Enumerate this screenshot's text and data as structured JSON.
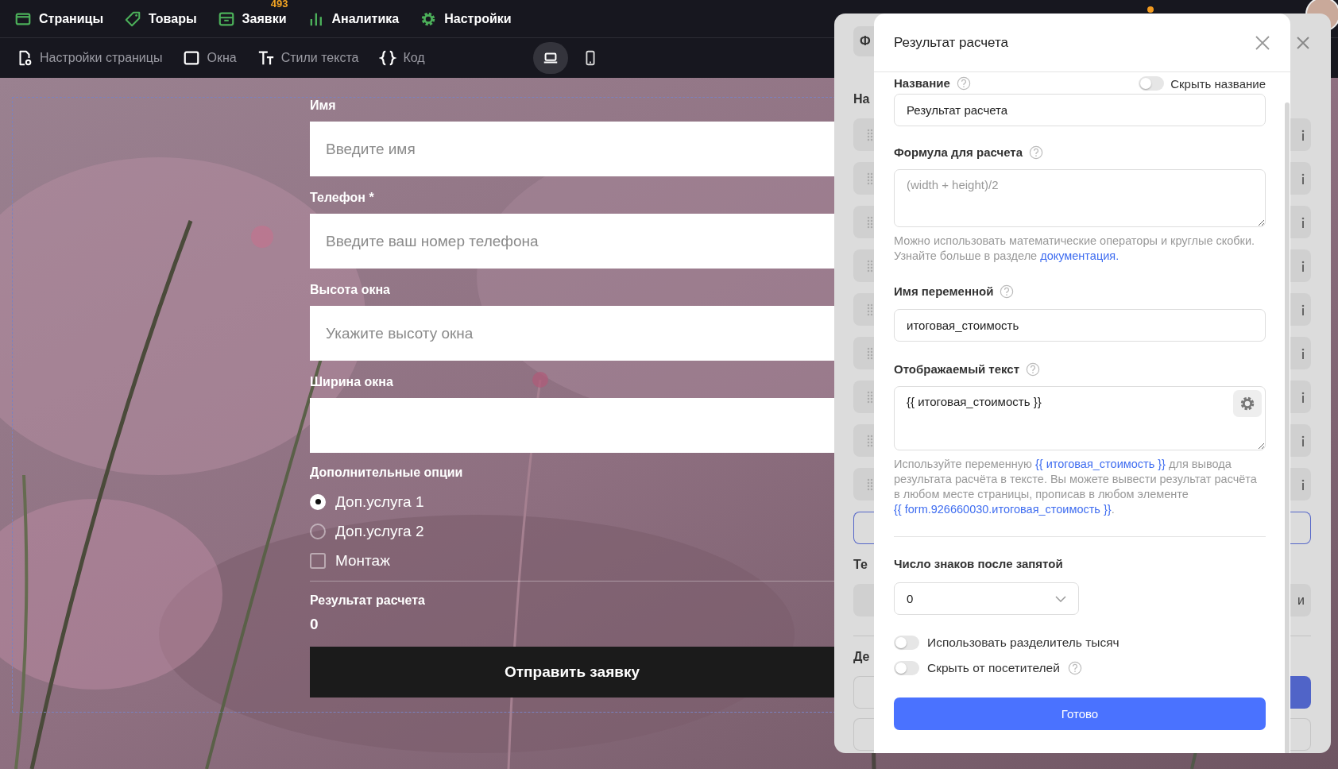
{
  "nav": {
    "items": [
      {
        "kind": "pages",
        "label": "Страницы"
      },
      {
        "kind": "products",
        "label": "Товары"
      },
      {
        "kind": "orders",
        "label": "Заявки",
        "badge": "493"
      },
      {
        "kind": "analytics",
        "label": "Аналитика"
      },
      {
        "kind": "settings",
        "label": "Настройки"
      }
    ]
  },
  "toolbar": {
    "items": [
      {
        "kind": "page-settings",
        "label": "Настройки страницы"
      },
      {
        "kind": "windows",
        "label": "Окна"
      },
      {
        "kind": "text-styles",
        "label": "Стили текста"
      },
      {
        "kind": "code",
        "label": "Код"
      }
    ],
    "devices": [
      {
        "kind": "desktop",
        "selected": true
      },
      {
        "kind": "mobile",
        "selected": false
      }
    ]
  },
  "form": {
    "fields": [
      {
        "label": "Имя",
        "placeholder": "Введите имя"
      },
      {
        "label": "Телефон *",
        "placeholder": "Введите ваш номер телефона"
      },
      {
        "label": "Высота окна",
        "placeholder": "Укажите высоту окна"
      },
      {
        "label": "Ширина окна"
      }
    ],
    "options_title": "Дополнительные опции",
    "options": [
      {
        "kind": "radio",
        "label": "Доп.услуга 1",
        "checked": true
      },
      {
        "kind": "radio",
        "label": "Доп.услуга 2",
        "checked": false
      },
      {
        "kind": "checkbox",
        "label": "Монтаж",
        "checked": false
      }
    ],
    "result_label": "Результат расчета",
    "result_value": "0",
    "submit": "Отправить заявку"
  },
  "back_panel": {
    "tab": "Ф",
    "section_1": "На",
    "section_2": "Те",
    "field_end": "и",
    "section_3": "Де"
  },
  "modal": {
    "title": "Результат расчета",
    "name_label": "Название",
    "hide_name": {
      "label": "Скрыть название",
      "on": false
    },
    "name_value": "Результат расчета",
    "formula_label": "Формула для расчета",
    "formula_placeholder": "(width + height)/2",
    "formula_hint": [
      {
        "kind": "text",
        "text": "Можно использовать математические операторы и круглые скобки. Узнайте больше в разделе "
      },
      {
        "kind": "link",
        "text": "документация."
      }
    ],
    "variable_label": "Имя переменной",
    "variable_value": "итоговая_стоимость",
    "display_label": "Отображаемый текст",
    "display_value": "{{ итоговая_стоимость }}",
    "display_hint": [
      {
        "kind": "text",
        "text": "Используйте переменную "
      },
      {
        "kind": "link",
        "text": "{{ итоговая_стоимость }}"
      },
      {
        "kind": "text",
        "text": " для вывода результата расчёта в тексте. Вы можете вывести результат расчёта в любом месте страницы, прописав в любом элементе "
      },
      {
        "kind": "link",
        "text": "{{ form.926660030.итоговая_стоимость }}"
      },
      {
        "kind": "text",
        "text": "."
      }
    ],
    "decimals_label": "Число знаков после запятой",
    "decimals_value": "0",
    "toggles": [
      {
        "label": "Использовать разделитель тысяч",
        "on": false,
        "help": false
      },
      {
        "label": "Скрыть от посетителей",
        "on": false,
        "help": true
      }
    ],
    "done": "Готово"
  }
}
